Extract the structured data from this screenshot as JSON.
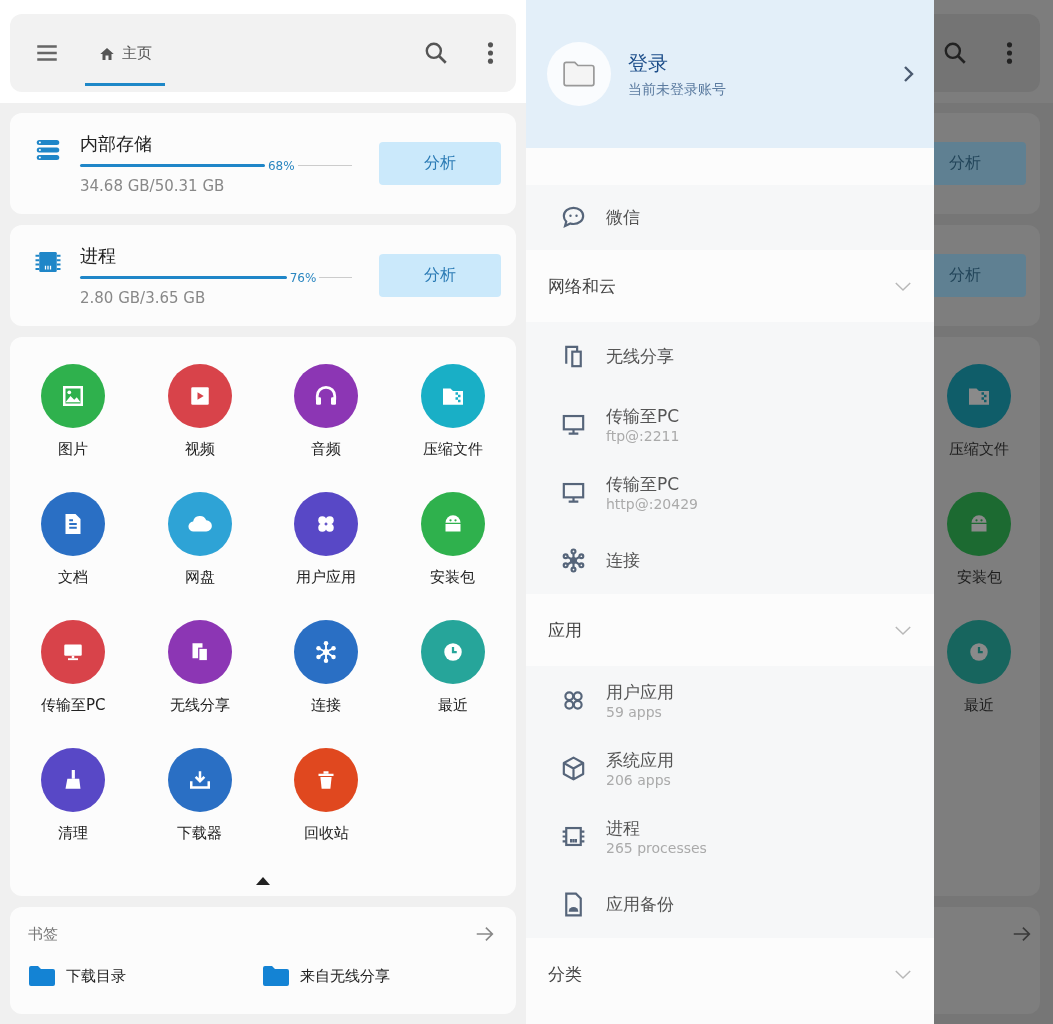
{
  "main": {
    "toolbar": {
      "tab": {
        "label": "主页",
        "selected": true
      }
    },
    "storage_cards": [
      {
        "kind": "storage",
        "title": "内部存储",
        "level": 0.68,
        "percent": "68%",
        "usage": "34.68 GB/50.31 GB",
        "button": "分析"
      },
      {
        "kind": "process",
        "title": "进程",
        "level": 0.76,
        "percent": "76%",
        "usage": "2.80 GB/3.65 GB",
        "button": "分析"
      }
    ],
    "categories": [
      {
        "label": "图片",
        "kind": "image",
        "color": "#2fb14d"
      },
      {
        "label": "视频",
        "kind": "video",
        "color": "#d8434a"
      },
      {
        "label": "音频",
        "kind": "audio",
        "color": "#8c36b4"
      },
      {
        "label": "压缩文件",
        "kind": "archive",
        "color": "#19afc6"
      },
      {
        "label": "文档",
        "kind": "doc",
        "color": "#2a6fc4"
      },
      {
        "label": "网盘",
        "kind": "cloud",
        "color": "#2ea3d6"
      },
      {
        "label": "用户应用",
        "kind": "apps",
        "color": "#5848c6"
      },
      {
        "label": "安装包",
        "kind": "android",
        "color": "#2fb14d"
      },
      {
        "label": "传输至PC",
        "kind": "pc",
        "color": "#d8434a"
      },
      {
        "label": "无线分享",
        "kind": "share",
        "color": "#8c36b4"
      },
      {
        "label": "连接",
        "kind": "connect",
        "color": "#2a6fc4"
      },
      {
        "label": "最近",
        "kind": "clock",
        "color": "#26a59a"
      },
      {
        "label": "清理",
        "kind": "broom",
        "color": "#5848c6"
      },
      {
        "label": "下载器",
        "kind": "download",
        "color": "#2a6fc4"
      },
      {
        "label": "回收站",
        "kind": "trash",
        "color": "#e0481f"
      }
    ],
    "bookmarks": {
      "title": "书签",
      "items": [
        {
          "label": "下载目录"
        },
        {
          "label": "来自无线分享"
        }
      ]
    }
  },
  "drawer": {
    "account": {
      "title": "登录",
      "subtitle": "当前未登录账号"
    },
    "groups": [
      {
        "children": [
          {
            "kind": "chat",
            "title": "微信"
          }
        ]
      },
      {
        "title": "网络和云",
        "children": [
          {
            "kind": "devices",
            "title": "无线分享"
          },
          {
            "kind": "monitor",
            "title": "传输至PC",
            "subtitle": "ftp@:2211"
          },
          {
            "kind": "monitor",
            "title": "传输至PC",
            "subtitle": "http@:20429"
          },
          {
            "kind": "hub",
            "title": "连接"
          }
        ]
      },
      {
        "title": "应用",
        "children": [
          {
            "kind": "apps",
            "title": "用户应用",
            "subtitle": "59 apps"
          },
          {
            "kind": "cube",
            "title": "系统应用",
            "subtitle": "206 apps"
          },
          {
            "kind": "chip",
            "title": "进程",
            "subtitle": "265 processes"
          },
          {
            "kind": "apk",
            "title": "应用备份"
          }
        ]
      },
      {
        "title": "分类"
      }
    ]
  },
  "dimmed_background": {
    "buttons": [
      "分析",
      "分析"
    ],
    "tiles": [
      {
        "label": "压缩文件",
        "kind": "archive",
        "color": "#0f5d69"
      },
      {
        "label": "安装包",
        "kind": "android",
        "color": "#1c6a31"
      },
      {
        "label": "最近",
        "kind": "clock",
        "color": "#17655e"
      }
    ]
  }
}
